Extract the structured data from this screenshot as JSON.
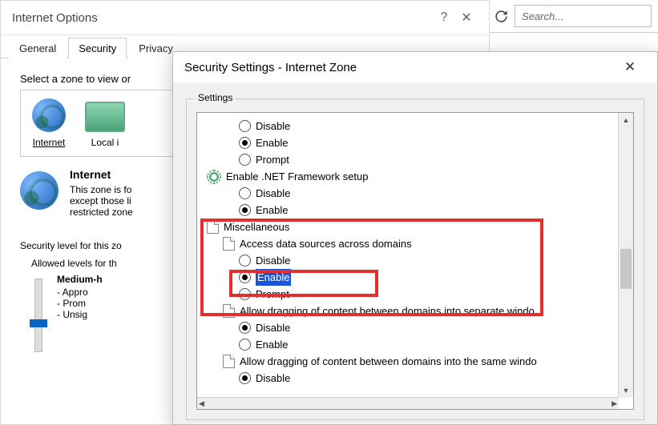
{
  "browser": {
    "search_placeholder": "Search..."
  },
  "internet_options": {
    "title": "Internet Options",
    "tabs": [
      "General",
      "Security",
      "Privacy"
    ],
    "active_tab": 1,
    "zone_hint": "Select a zone to view or",
    "zones": [
      {
        "label": "Internet",
        "selected": true
      },
      {
        "label": "Local i"
      }
    ],
    "desc": {
      "title": "Internet",
      "line1": "This zone is fo",
      "line2": "except those li",
      "line3": "restricted zone"
    },
    "sec_level_caption": "Security level for this zo",
    "allowed_caption": "Allowed levels for th",
    "level_name": "Medium-h",
    "bul1": "- Appro",
    "bul2": "- Prom",
    "bul3": "- Unsig"
  },
  "security_settings": {
    "title": "Security Settings - Internet Zone",
    "group_label": "Settings",
    "items": [
      {
        "kind": "radio",
        "depth": 2,
        "label": "Disable",
        "checked": false
      },
      {
        "kind": "radio",
        "depth": 2,
        "label": "Enable",
        "checked": true
      },
      {
        "kind": "radio",
        "depth": 2,
        "label": "Prompt",
        "checked": false
      },
      {
        "kind": "cat",
        "depth": 0,
        "icon": "gear",
        "label": "Enable .NET Framework setup"
      },
      {
        "kind": "radio",
        "depth": 2,
        "label": "Disable",
        "checked": false
      },
      {
        "kind": "radio",
        "depth": 2,
        "label": "Enable",
        "checked": true
      },
      {
        "kind": "cat",
        "depth": 0,
        "icon": "doc",
        "label": "Miscellaneous"
      },
      {
        "kind": "cat",
        "depth": 1,
        "icon": "doc",
        "label": "Access data sources across domains"
      },
      {
        "kind": "radio",
        "depth": 2,
        "label": "Disable",
        "checked": false
      },
      {
        "kind": "radio",
        "depth": 2,
        "label": "Enable",
        "checked": true,
        "selected": true
      },
      {
        "kind": "radio",
        "depth": 2,
        "label": "Prompt",
        "checked": false
      },
      {
        "kind": "cat",
        "depth": 1,
        "icon": "doc",
        "label": "Allow dragging of content between domains into separate windo"
      },
      {
        "kind": "radio",
        "depth": 2,
        "label": "Disable",
        "checked": true
      },
      {
        "kind": "radio",
        "depth": 2,
        "label": "Enable",
        "checked": false
      },
      {
        "kind": "cat",
        "depth": 1,
        "icon": "doc",
        "label": "Allow dragging of content between domains into the same windo"
      },
      {
        "kind": "radio",
        "depth": 2,
        "label": "Disable",
        "checked": true
      }
    ]
  }
}
